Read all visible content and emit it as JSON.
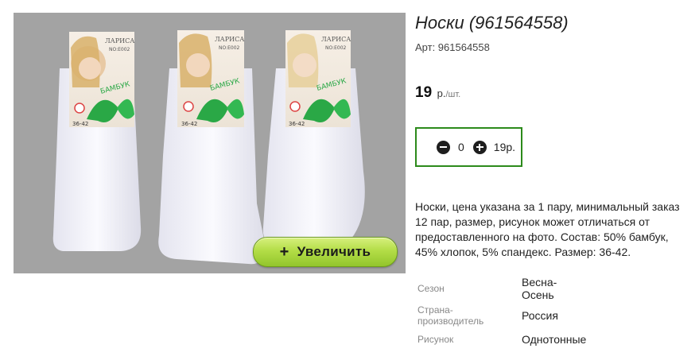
{
  "product": {
    "title": "Носки (961564558)",
    "article": "Арт: 961564558",
    "price_value": "19",
    "price_currency": "р.",
    "price_unit": "/шт.",
    "description": "Носки, цена указана за 1 пару, минимальный заказ 12 пар, размер, рисунок может отличаться от предоставленного на фото. Состав: 50% бамбук, 45% хлопок, 5% спандекс. Размер: 36-42."
  },
  "image": {
    "zoom_label": "Увеличить",
    "zoom_plus": "+",
    "package_brand": "ЛАРИСА",
    "package_code": "NO:E002",
    "package_label": "БАМБУК",
    "package_size": "36-42",
    "background_color": "#a3a3a3",
    "sock_color": "#f4f4fb",
    "ribbon_color": "#2aa846"
  },
  "quantity": {
    "value": "0",
    "sum": "19р."
  },
  "specs": {
    "season_label": "Сезон",
    "season_value_line1": "Весна-",
    "season_value_line2": "Осень",
    "country_label_line1": "Страна-",
    "country_label_line2": "производитель",
    "country_value": "Россия",
    "pattern_label": "Рисунок",
    "pattern_value": "Однотонные"
  },
  "colors": {
    "accent_border": "#2c8a1b",
    "zoom_button": "#b3dd47"
  }
}
